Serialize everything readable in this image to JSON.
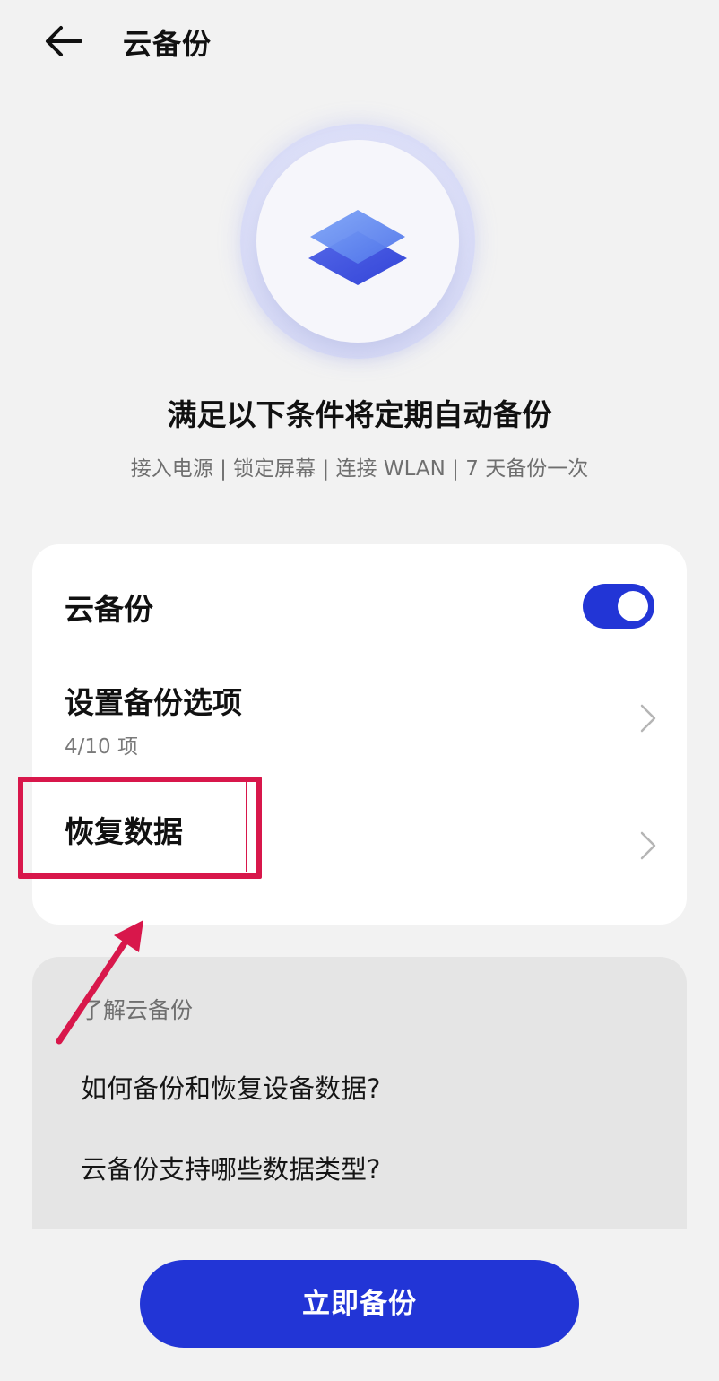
{
  "header": {
    "title": "云备份"
  },
  "hero": {
    "condition_title": "满足以下条件将定期自动备份",
    "condition_subtitle": "接入电源 | 锁定屏幕 | 连接 WLAN | 7 天备份一次"
  },
  "settings": {
    "cloud_backup_label": "云备份",
    "cloud_backup_enabled": true,
    "backup_options_label": "设置备份选项",
    "backup_options_count": "4/10 项",
    "restore_label": "恢复数据"
  },
  "learn": {
    "title": "了解云备份",
    "links": [
      "如何备份和恢复设备数据?",
      "云备份支持哪些数据类型?"
    ]
  },
  "footer": {
    "backup_now_label": "立即备份"
  },
  "colors": {
    "accent": "#2235d6",
    "annotation": "#d8174b"
  }
}
